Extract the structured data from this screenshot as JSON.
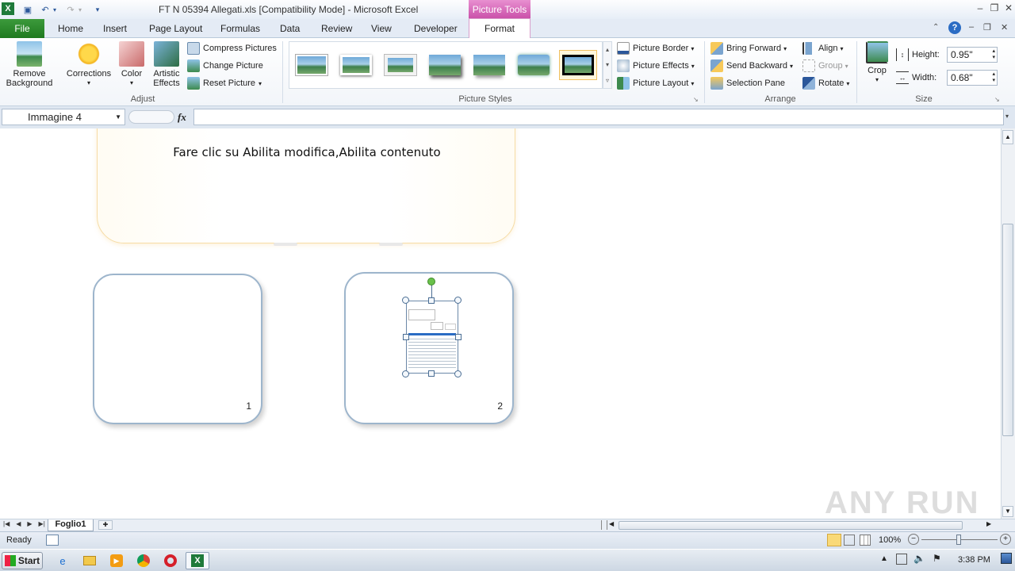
{
  "window": {
    "title": "FT N 05394 Allegati.xls  [Compatibility Mode]  -  Microsoft Excel",
    "context_tab_group": "Picture Tools",
    "controls": {
      "minimize": "–",
      "restore": "❐",
      "close": "✕"
    },
    "inner_controls": {
      "help": "?",
      "minimize": "–",
      "restore": "❐",
      "close": "✕"
    }
  },
  "tabs": [
    "File",
    "Home",
    "Insert",
    "Page Layout",
    "Formulas",
    "Data",
    "Review",
    "View",
    "Developer",
    "Format"
  ],
  "ribbon": {
    "adjust": {
      "label": "Adjust",
      "remove_background": [
        "Remove",
        "Background"
      ],
      "corrections": "Corrections",
      "color": "Color",
      "artistic_effects": [
        "Artistic",
        "Effects"
      ],
      "compress": "Compress Pictures",
      "change": "Change Picture",
      "reset": "Reset Picture"
    },
    "picture_styles": {
      "label": "Picture Styles",
      "border": "Picture Border",
      "effects": "Picture Effects",
      "layout": "Picture Layout"
    },
    "arrange": {
      "label": "Arrange",
      "bring_forward": "Bring Forward",
      "send_backward": "Send Backward",
      "selection_pane": "Selection Pane",
      "align": "Align",
      "group": "Group",
      "rotate": "Rotate"
    },
    "size": {
      "label": "Size",
      "crop": "Crop",
      "height_label": "Height:",
      "height_value": "0.95\"",
      "width_label": "Width:",
      "width_value": "0.68\""
    }
  },
  "formula_bar": {
    "name_box": "Immagine 4",
    "fx": "fx",
    "value": ""
  },
  "sheet": {
    "banner_text": "Fare clic su Abilita modifica,Abilita contenuto",
    "card1_number": "1",
    "card2_number": "2"
  },
  "sheet_tabs": {
    "active": "Foglio1"
  },
  "status": {
    "ready": "Ready",
    "zoom": "100%"
  },
  "taskbar": {
    "start": "Start",
    "time": "3:38 PM"
  },
  "watermark": "ANY RUN",
  "colors": {
    "file_tab": "#2a8a2a",
    "context_tab": "#c94ea8",
    "selection_handle": "#4b6e94",
    "rotate_handle": "#6ac14b"
  }
}
